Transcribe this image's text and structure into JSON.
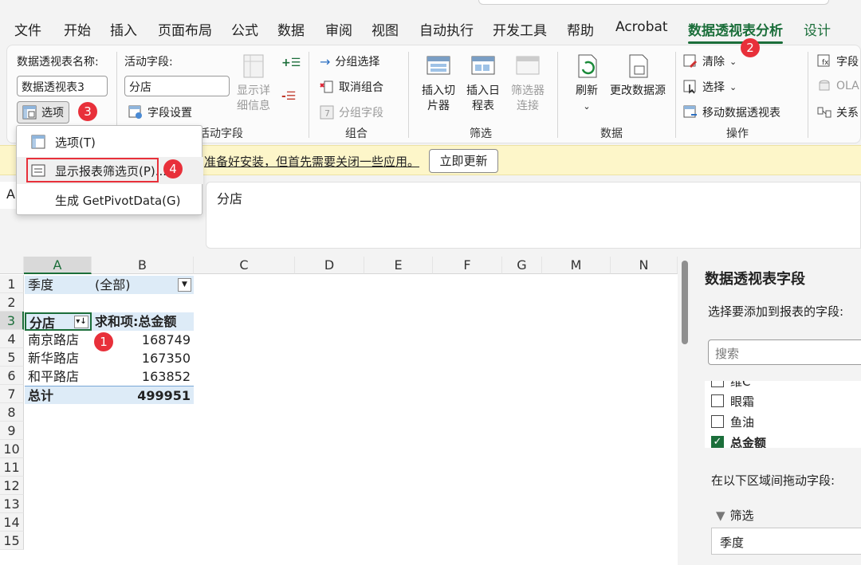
{
  "menu_tabs": [
    "文件",
    "开始",
    "插入",
    "页面布局",
    "公式",
    "数据",
    "审阅",
    "视图",
    "自动执行",
    "开发工具",
    "帮助",
    "Acrobat",
    "数据透视表分析",
    "设计"
  ],
  "active_tab": "数据透视表分析",
  "ribbon": {
    "pivot_name_label": "数据透视表名称:",
    "pivot_name_value": "数据透视表3",
    "options_button": "选项",
    "active_field_label": "活动字段:",
    "active_field_value": "分店",
    "field_settings": "字段设置",
    "show_details": "显示详细信息",
    "active_field_group": "活动字段",
    "group_selection": "分组选择",
    "ungroup": "取消组合",
    "group_field": "分组字段",
    "group_label": "组合",
    "insert_slicer": "插入切片器",
    "insert_timeline": "插入日程表",
    "filter_connections": "筛选器连接",
    "filter_label": "筛选",
    "refresh": "刷新",
    "change_source": "更改数据源",
    "data_label": "数据",
    "clear": "清除",
    "select": "选择",
    "move_pivot": "移动数据透视表",
    "actions_label": "操作",
    "fields_btn": "字段",
    "olap_btn": "OLA",
    "relations_btn": "关系"
  },
  "dropdown": {
    "items": [
      "选项(T)",
      "显示报表筛选页(P)...",
      "生成 GetPivotData(G)"
    ]
  },
  "message_bar": {
    "text": "准备好安装，但首先需要关闭一些应用。",
    "button": "立即更新"
  },
  "name_box": "A",
  "formula_value": "分店",
  "sheet": {
    "columns": [
      "A",
      "B",
      "C",
      "D",
      "E",
      "F",
      "G",
      "M",
      "N"
    ],
    "rows": [
      "1",
      "2",
      "3",
      "4",
      "5",
      "6",
      "7",
      "8",
      "9",
      "10",
      "11",
      "12",
      "13",
      "14",
      "15"
    ],
    "filter_label": "季度",
    "filter_value": "(全部)",
    "header_a": "分店",
    "header_b": "求和项:总金额",
    "data": [
      {
        "store": "南京路店",
        "amount": "168749"
      },
      {
        "store": "新华路店",
        "amount": "167350"
      },
      {
        "store": "和平路店",
        "amount": "163852"
      }
    ],
    "total_label": "总计",
    "total_value": "499951"
  },
  "badges": [
    "1",
    "2",
    "3",
    "4"
  ],
  "pane": {
    "title": "数据透视表字段",
    "subtitle": "选择要添加到报表的字段:",
    "search_placeholder": "搜索",
    "fields": [
      {
        "name": "维C",
        "checked": false
      },
      {
        "name": "眼霜",
        "checked": false
      },
      {
        "name": "鱼油",
        "checked": false
      },
      {
        "name": "总金额",
        "checked": true
      }
    ],
    "drag_text": "在以下区域间拖动字段:",
    "filter_area_label": "筛选",
    "filter_area_value": "季度"
  }
}
